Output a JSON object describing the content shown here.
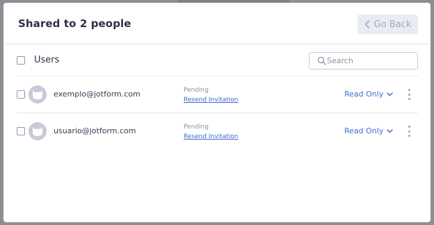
{
  "dialog": {
    "title": "Shared to 2 people",
    "go_back_label": "Go Back"
  },
  "users_bar": {
    "label": "Users",
    "search_placeholder": "Search"
  },
  "users": [
    {
      "email": "exemplo@jotform.com",
      "status": "Pending",
      "resend_label": "Resend Invitation",
      "permission": "Read Only"
    },
    {
      "email": "usuario@jotform.com",
      "status": "Pending",
      "resend_label": "Resend Invitation",
      "permission": "Read Only"
    }
  ],
  "colors": {
    "accent": "#3e6fd6",
    "title": "#2b3245",
    "avatar": "#c7cad9",
    "go_back_bg": "#e9ebf2"
  },
  "icons": {
    "go_back": "chevron-left-icon",
    "search": "search-icon",
    "avatar": "cat-avatar-icon",
    "permission": "chevron-down-icon",
    "more": "more-vertical-icon"
  }
}
